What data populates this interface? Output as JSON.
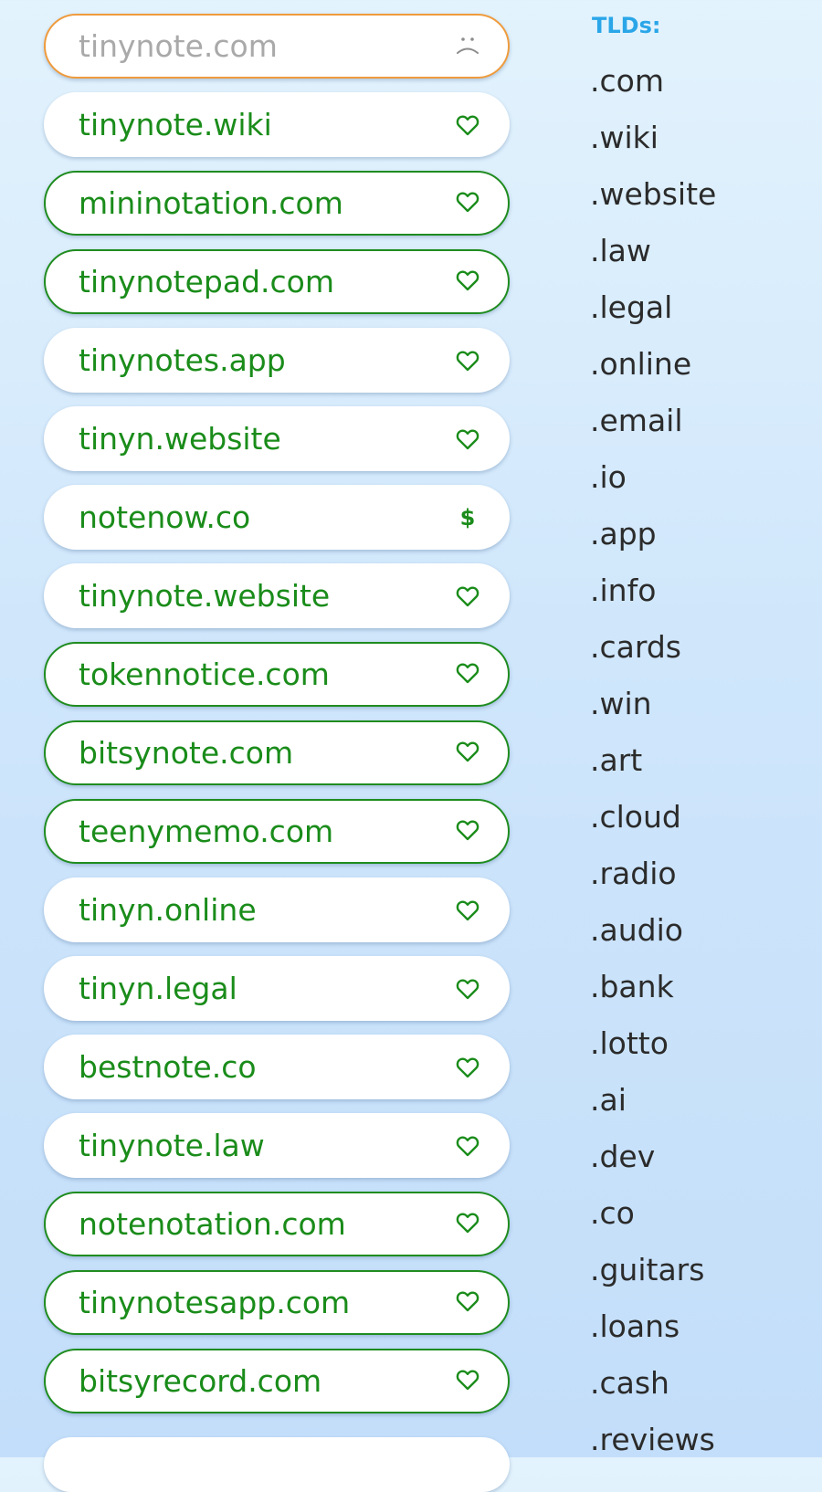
{
  "domains": [
    {
      "name": "tinynote.com",
      "style": "taken",
      "icon": "sad-face-icon"
    },
    {
      "name": "tinynote.wiki",
      "style": "plain",
      "icon": "heart-icon"
    },
    {
      "name": "mininotation.com",
      "style": "outlined",
      "icon": "heart-icon"
    },
    {
      "name": "tinynotepad.com",
      "style": "outlined",
      "icon": "heart-icon"
    },
    {
      "name": "tinynotes.app",
      "style": "plain",
      "icon": "heart-icon"
    },
    {
      "name": "tinyn.website",
      "style": "plain",
      "icon": "heart-icon"
    },
    {
      "name": "notenow.co",
      "style": "plain",
      "icon": "dollar-icon",
      "icon_text": "$"
    },
    {
      "name": "tinynote.website",
      "style": "plain",
      "icon": "heart-icon"
    },
    {
      "name": "tokennotice.com",
      "style": "outlined",
      "icon": "heart-icon"
    },
    {
      "name": "bitsynote.com",
      "style": "outlined",
      "icon": "heart-icon"
    },
    {
      "name": "teenymemo.com",
      "style": "outlined",
      "icon": "heart-icon"
    },
    {
      "name": "tinyn.online",
      "style": "plain",
      "icon": "heart-icon"
    },
    {
      "name": "tinyn.legal",
      "style": "plain",
      "icon": "heart-icon"
    },
    {
      "name": "bestnote.co",
      "style": "plain",
      "icon": "heart-icon"
    },
    {
      "name": "tinynote.law",
      "style": "plain",
      "icon": "heart-icon"
    },
    {
      "name": "notenotation.com",
      "style": "outlined",
      "icon": "heart-icon"
    },
    {
      "name": "tinynotesapp.com",
      "style": "outlined",
      "icon": "heart-icon"
    },
    {
      "name": "bitsyrecord.com",
      "style": "outlined",
      "icon": "heart-icon"
    }
  ],
  "tld_panel": {
    "header": "TLDs:",
    "items": [
      ".com",
      ".wiki",
      ".website",
      ".law",
      ".legal",
      ".online",
      ".email",
      ".io",
      ".app",
      ".info",
      ".cards",
      ".win",
      ".art",
      ".cloud",
      ".radio",
      ".audio",
      ".bank",
      ".lotto",
      ".ai",
      ".dev",
      ".co",
      ".guitars",
      ".loans",
      ".cash",
      ".reviews"
    ]
  },
  "colors": {
    "available_text": "#1a8c1a",
    "available_outline": "#1f8c1f",
    "taken_outline": "#ef9b3d",
    "taken_text": "#a9a9a9",
    "tld_header": "#2aa6e8",
    "tld_text": "#2b2b2b"
  }
}
